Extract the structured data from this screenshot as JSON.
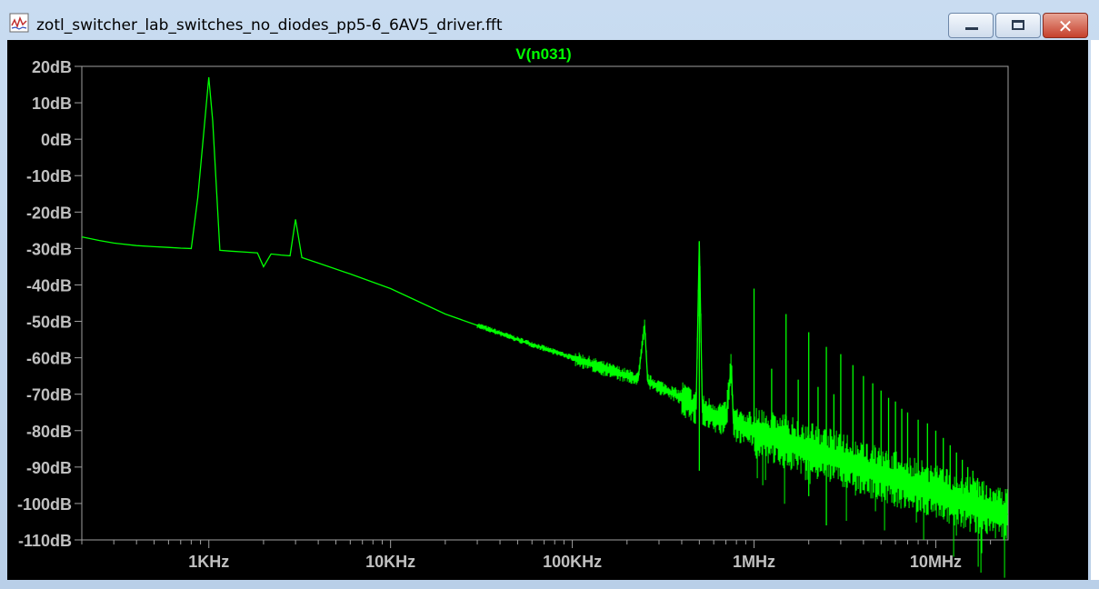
{
  "window": {
    "title": "zotl_switcher_lab_switches_no_diodes_pp5-6_6AV5_driver.fft",
    "icon": "waveform-icon",
    "controls": {
      "minimize": "minimize-icon",
      "maximize": "maximize-icon",
      "close": "close-icon",
      "close_glyph": "✕"
    }
  },
  "colors": {
    "background": "#000000",
    "trace": "#00ff00",
    "axis_text": "#c0c0c0",
    "frame": "#a0a0a0",
    "close_button": "#c6402b"
  },
  "chart_data": {
    "type": "line",
    "title": "V(n031)",
    "xscale": "log",
    "xlim": [
      200,
      25000000
    ],
    "ylim": [
      -110,
      20
    ],
    "xlabel": "",
    "ylabel": "",
    "grid": false,
    "x_ticks": [
      {
        "value": 1000,
        "label": "1KHz"
      },
      {
        "value": 10000,
        "label": "10KHz"
      },
      {
        "value": 100000,
        "label": "100KHz"
      },
      {
        "value": 1000000,
        "label": "1MHz"
      },
      {
        "value": 10000000,
        "label": "10MHz"
      }
    ],
    "y_ticks": [
      {
        "value": 20,
        "label": "20dB"
      },
      {
        "value": 10,
        "label": "10dB"
      },
      {
        "value": 0,
        "label": "0dB"
      },
      {
        "value": -10,
        "label": "-10dB"
      },
      {
        "value": -20,
        "label": "-20dB"
      },
      {
        "value": -30,
        "label": "-30dB"
      },
      {
        "value": -40,
        "label": "-40dB"
      },
      {
        "value": -50,
        "label": "-50dB"
      },
      {
        "value": -60,
        "label": "-60dB"
      },
      {
        "value": -70,
        "label": "-70dB"
      },
      {
        "value": -80,
        "label": "-80dB"
      },
      {
        "value": -90,
        "label": "-90dB"
      },
      {
        "value": -100,
        "label": "-100dB"
      },
      {
        "value": -110,
        "label": "-110dB"
      }
    ],
    "series": [
      {
        "color": "#00ff00",
        "x": [
          200,
          250,
          300,
          400,
          500,
          600,
          700,
          800,
          870,
          950,
          1000,
          1050,
          1150,
          1300,
          1600,
          1850,
          2000,
          2200,
          2500,
          2800,
          3000,
          3250,
          4000,
          6000,
          10000,
          20000,
          50000,
          100000,
          150000,
          200000,
          230000,
          250000,
          260000,
          300000,
          400000,
          480000,
          500000,
          520000,
          600000,
          700000,
          750000,
          770000,
          1000000,
          1500000,
          2000000,
          3000000,
          5000000,
          10000000,
          15000000,
          20000000,
          25000000
        ],
        "y": [
          -26.8,
          -27.8,
          -28.5,
          -29.2,
          -29.5,
          -29.7,
          -29.9,
          -30.0,
          -16.0,
          5.0,
          17.0,
          5.0,
          -30.5,
          -30.7,
          -31.0,
          -31.2,
          -35.0,
          -31.5,
          -31.8,
          -32.0,
          -22.0,
          -32.5,
          -34.0,
          -37.0,
          -41.0,
          -48.0,
          -55.0,
          -60.0,
          -63.0,
          -65.0,
          -66.0,
          -51.0,
          -66.5,
          -68.0,
          -71.0,
          -74.0,
          -28.0,
          -75.0,
          -76.0,
          -77.0,
          -62.0,
          -78.0,
          -80.0,
          -83.0,
          -85.0,
          -88.0,
          -92.0,
          -97.0,
          -100.0,
          -102.0,
          -103.0
        ]
      }
    ],
    "harmonic_spikes": [
      {
        "x": 500000,
        "peak": -28,
        "dip": -91
      },
      {
        "x": 750000,
        "peak": -62
      },
      {
        "x": 1000000,
        "peak": -41
      },
      {
        "x": 1250000,
        "peak": -63
      },
      {
        "x": 1500000,
        "peak": -48
      },
      {
        "x": 1750000,
        "peak": -66
      },
      {
        "x": 2000000,
        "peak": -53,
        "dip": -98
      },
      {
        "x": 2250000,
        "peak": -68
      },
      {
        "x": 2500000,
        "peak": -57,
        "dip": -106
      },
      {
        "x": 2750000,
        "peak": -70
      },
      {
        "x": 3000000,
        "peak": -59
      },
      {
        "x": 3500000,
        "peak": -62
      },
      {
        "x": 4000000,
        "peak": -65
      },
      {
        "x": 4500000,
        "peak": -67
      },
      {
        "x": 5000000,
        "peak": -69
      },
      {
        "x": 5500000,
        "peak": -71
      },
      {
        "x": 6000000,
        "peak": -72
      },
      {
        "x": 6500000,
        "peak": -74
      },
      {
        "x": 7000000,
        "peak": -75
      },
      {
        "x": 8000000,
        "peak": -77
      },
      {
        "x": 9000000,
        "peak": -78
      },
      {
        "x": 10000000,
        "peak": -80
      },
      {
        "x": 11000000,
        "peak": -82
      },
      {
        "x": 12000000,
        "peak": -84
      },
      {
        "x": 13000000,
        "peak": -86
      },
      {
        "x": 14000000,
        "peak": -88
      },
      {
        "x": 15000000,
        "peak": -90
      },
      {
        "x": 16000000,
        "peak": -91
      },
      {
        "x": 17000000,
        "peak": -93
      },
      {
        "x": 18000000,
        "peak": -94
      },
      {
        "x": 19000000,
        "peak": -95
      },
      {
        "x": 20000000,
        "peak": -96
      },
      {
        "x": 21000000,
        "peak": -97
      },
      {
        "x": 22000000,
        "peak": -98
      }
    ]
  }
}
